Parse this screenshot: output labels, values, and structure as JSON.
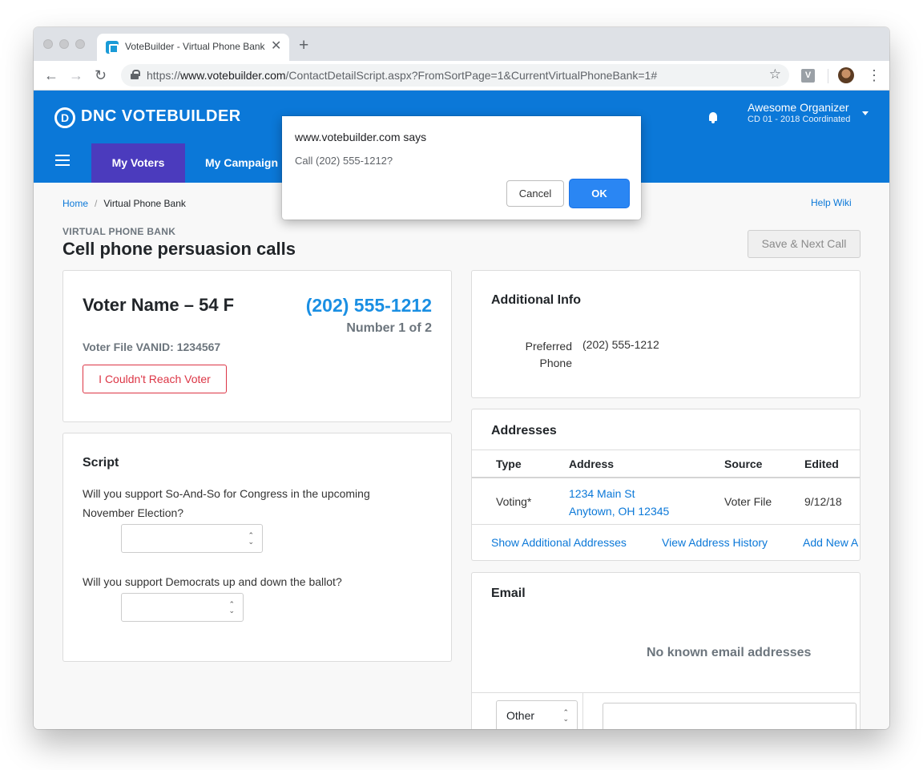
{
  "browser": {
    "tab_title": "VoteBuilder - Virtual Phone Bank",
    "url_prefix": "https://",
    "url_host": "www.votebuilder.com",
    "url_path": "/ContactDetailScript.aspx?FromSortPage=1&CurrentVirtualPhoneBank=1#",
    "extension_letter": "V"
  },
  "appbar": {
    "logo_mark": "D",
    "logo_text": "DNC VOTEBUILDER",
    "user_name": "Awesome Organizer",
    "user_org": "CD 01 - 2018 Coordinated",
    "nav": [
      "My Voters",
      "My Campaign"
    ]
  },
  "breadcrumb": {
    "home": "Home",
    "separator": "/",
    "current": "Virtual Phone Bank"
  },
  "help_link": "Help Wiki",
  "header": {
    "section_label": "VIRTUAL PHONE BANK",
    "title": "Cell phone persuasion calls",
    "save_next_label": "Save & Next Call"
  },
  "voter": {
    "name": "Voter Name – 54 F",
    "phone": "(202) 555-1212",
    "number_of": "Number 1 of 2",
    "vanid": "Voter File VANID: 1234567",
    "couldnt_reach_label": "I Couldn't Reach Voter"
  },
  "script": {
    "title": "Script",
    "questions": [
      {
        "text": "Will you support So-And-So for Congress in the upcoming November Election?",
        "value": ""
      },
      {
        "text": "Will you support Democrats up and down the ballot?",
        "value": ""
      }
    ]
  },
  "additional_info": {
    "title": "Additional Info",
    "preferred_label_line1": "Preferred",
    "preferred_label_line2": "Phone",
    "preferred_value": "(202) 555-1212"
  },
  "addresses": {
    "title": "Addresses",
    "columns": [
      "Type",
      "Address",
      "Source",
      "Edited"
    ],
    "rows": [
      {
        "type": "Voting*",
        "address_line1": "1234 Main St",
        "address_line2": "Anytown, OH 12345",
        "source": "Voter File",
        "edited": "9/12/18"
      }
    ],
    "links": [
      "Show Additional Addresses",
      "View Address History",
      "Add New A"
    ]
  },
  "email": {
    "title": "Email",
    "empty_text": "No known email addresses",
    "type_select": "Other"
  },
  "dialog": {
    "title": "www.votebuilder.com says",
    "message": "Call (202) 555-1212?",
    "cancel_label": "Cancel",
    "ok_label": "OK"
  },
  "colors": {
    "brand": "#0b78d8",
    "nav_active": "#4b3bbd",
    "danger": "#dc3545",
    "dialog_ok": "#2a86f3"
  }
}
